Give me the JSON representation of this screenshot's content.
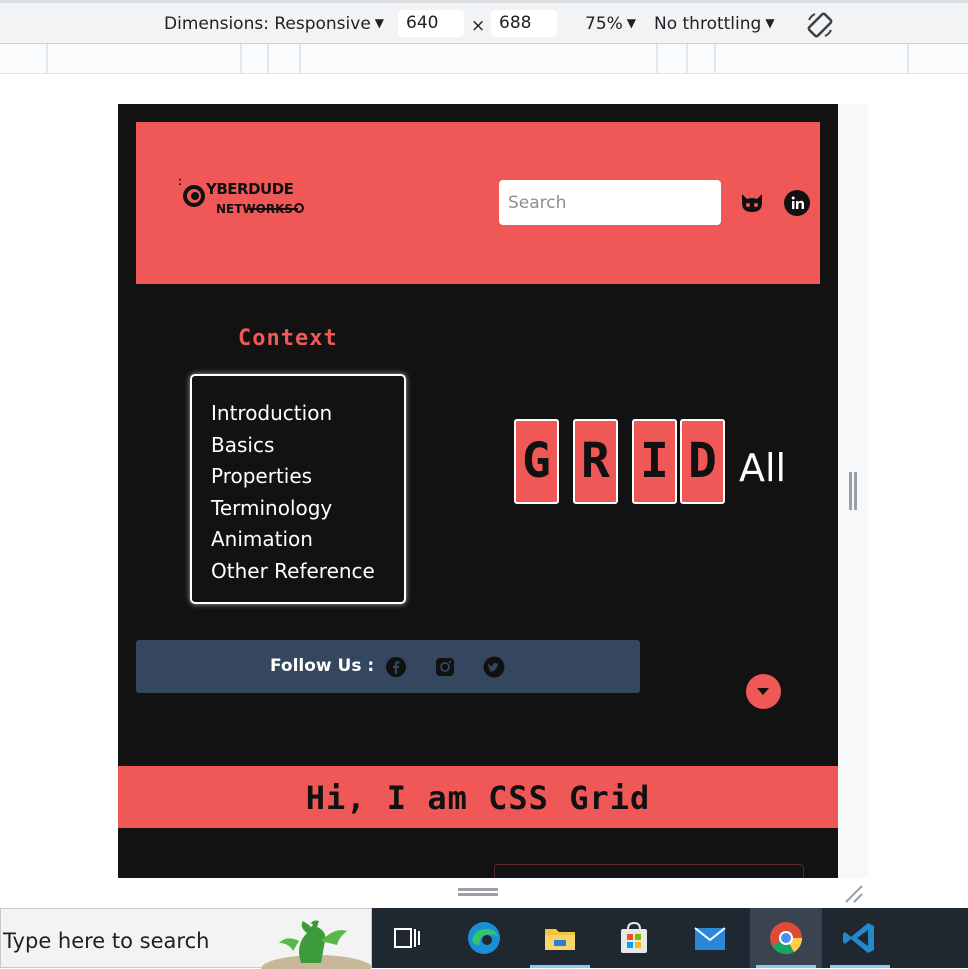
{
  "devtools": {
    "dimensions_label": "Dimensions: Responsive",
    "width_value": "640",
    "times_symbol": "×",
    "height_value": "688",
    "zoom_label": "75%",
    "throttling_label": "No throttling",
    "caret": "▼"
  },
  "site": {
    "logo": {
      "line1": "YBERDUDE",
      "line2": "NETWORKS"
    },
    "search": {
      "placeholder": "Search"
    },
    "context_title": "Context",
    "context_items": [
      "Introduction",
      "Basics",
      "Properties",
      "Terminology",
      "Animation",
      "Other Reference"
    ],
    "grid_letters": [
      "G",
      "R",
      "I",
      "D"
    ],
    "grid_suffix": "All",
    "follow_label": "Follow Us :",
    "hero_title": "Hi, I am CSS Grid",
    "colors": {
      "accent": "#f05858",
      "background": "#121212",
      "follow_bar": "#34475e"
    }
  },
  "taskbar": {
    "search_placeholder": "Type here to search",
    "apps": [
      "task-view",
      "edge",
      "file-explorer",
      "microsoft-store",
      "mail",
      "chrome",
      "vscode"
    ]
  }
}
